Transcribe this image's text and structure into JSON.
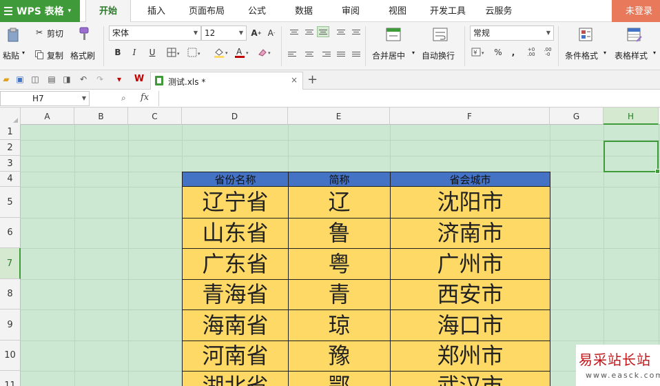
{
  "app": {
    "logo": "WPS 表格",
    "login": "未登录"
  },
  "menu": [
    "开始",
    "插入",
    "页面布局",
    "公式",
    "数据",
    "审阅",
    "视图",
    "开发工具",
    "云服务"
  ],
  "ribbon": {
    "cut": "剪切",
    "paste": "粘贴",
    "copy": "复制",
    "format_painter": "格式刷",
    "font_name": "宋体",
    "font_size": "12",
    "bold": "B",
    "italic": "I",
    "underline": "U",
    "merge_center": "合并居中",
    "wrap_text": "自动换行",
    "number_format": "常规",
    "percent": "%",
    "comma": ",",
    "conditional_format": "条件格式",
    "table_style": "表格样式",
    "colors": {
      "accent_green": "#3f9a3a",
      "font_color": "#c00000",
      "fill_color": "#ffd966"
    }
  },
  "document": {
    "tab_name": "测试.xls *",
    "close": "×",
    "add": "+"
  },
  "formula_bar": {
    "name_box": "H7",
    "fx": "fx",
    "value": ""
  },
  "grid": {
    "columns": [
      "A",
      "B",
      "C",
      "D",
      "E",
      "F",
      "G",
      "H"
    ],
    "rows": [
      "1",
      "2",
      "3",
      "4",
      "5",
      "6",
      "7",
      "8",
      "9",
      "10",
      "11"
    ],
    "selected_cell": "H7",
    "background": "#cde8d2"
  },
  "table": {
    "headers": [
      "省份名称",
      "简称",
      "省会城市"
    ],
    "header_color": "#4472c4",
    "rows": [
      [
        "辽宁省",
        "辽",
        "沈阳市"
      ],
      [
        "山东省",
        "鲁",
        "济南市"
      ],
      [
        "广东省",
        "粤",
        "广州市"
      ],
      [
        "青海省",
        "青",
        "西安市"
      ],
      [
        "海南省",
        "琼",
        "海口市"
      ],
      [
        "河南省",
        "豫",
        "郑州市"
      ],
      [
        "湖北省",
        "鄂",
        "武汉市"
      ]
    ]
  },
  "watermark": {
    "title": "易采站长站",
    "url": "www.easck.com"
  }
}
